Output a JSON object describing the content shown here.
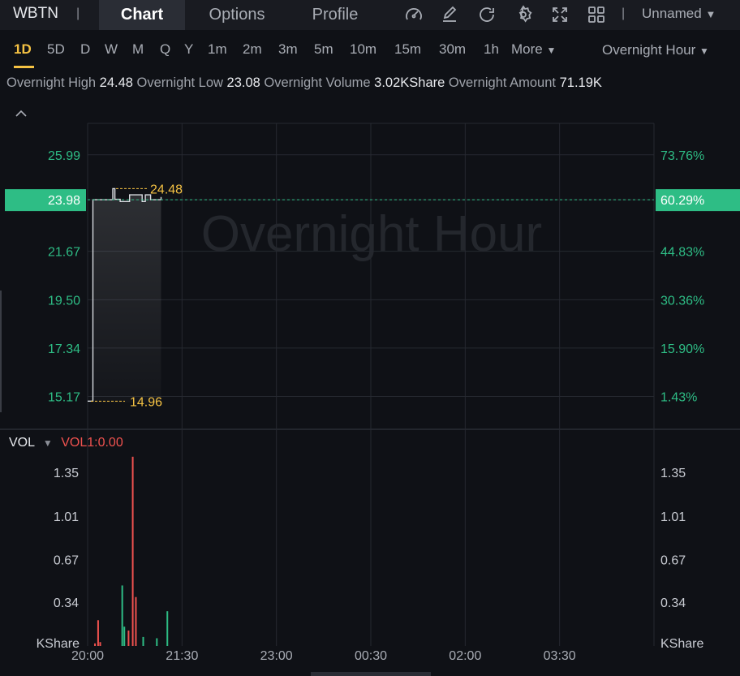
{
  "header": {
    "ticker": "WBTN",
    "tabs": [
      {
        "label": "Chart",
        "active": true
      },
      {
        "label": "Options",
        "active": false
      },
      {
        "label": "Profile",
        "active": false
      }
    ],
    "icons": [
      "gauge-icon",
      "draw-icon",
      "refresh-icon",
      "gear-icon",
      "fullscreen-icon",
      "layout-icon"
    ],
    "layout_name": "Unnamed"
  },
  "timeframes": {
    "items": [
      "1D",
      "5D",
      "D",
      "W",
      "M",
      "Q",
      "Y",
      "1m",
      "2m",
      "3m",
      "5m",
      "10m",
      "15m",
      "30m",
      "1h"
    ],
    "active": "1D",
    "more_label": "More",
    "session_label": "Overnight Hour"
  },
  "stats": {
    "high_label": "Overnight High",
    "high_value": "24.48",
    "low_label": "Overnight Low",
    "low_value": "23.08",
    "volume_label": "Overnight Volume",
    "volume_value": "3.02KShare",
    "amount_label": "Overnight Amount",
    "amount_value": "71.19K"
  },
  "colors": {
    "up": "#2ebd85",
    "down": "#f0524f",
    "accent": "#f5c243",
    "price_line": "#d8dbe0"
  },
  "chart_data": [
    {
      "type": "line",
      "watermark": "Overnight Hour",
      "x_ticks": [
        "20:00",
        "21:30",
        "23:00",
        "00:30",
        "02:00",
        "03:30"
      ],
      "x_minutes": [
        0,
        5,
        5,
        11,
        11,
        24,
        24,
        26,
        26,
        31,
        31,
        40,
        40,
        52,
        52,
        55,
        55,
        60,
        60,
        66,
        66,
        70,
        70
      ],
      "y": [
        14.96,
        14.96,
        23.98,
        23.98,
        23.98,
        23.98,
        24.48,
        24.48,
        24.0,
        24.0,
        23.9,
        23.9,
        24.2,
        24.2,
        23.9,
        23.9,
        24.2,
        24.2,
        23.98,
        23.98,
        23.98,
        23.98,
        24.1
      ],
      "y_ticks_left": [
        "25.99",
        "23.98",
        "21.67",
        "19.50",
        "17.34",
        "15.17"
      ],
      "y_ticks_right": [
        "73.76%",
        "60.29%",
        "44.83%",
        "30.36%",
        "15.90%",
        "1.43%"
      ],
      "ylim": [
        13.7,
        27.4
      ],
      "last_price": "23.98",
      "last_pct": "60.29%",
      "max_label": "24.48",
      "min_label": "14.96",
      "grid": true
    },
    {
      "type": "bar",
      "title": "VOL",
      "indicator": "VOL1:0.00",
      "unit": "KShare",
      "y_ticks": [
        "1.35",
        "1.01",
        "0.67",
        "0.34"
      ],
      "ylim": [
        0,
        1.62
      ],
      "bars": [
        {
          "minute": 7,
          "value": 0.02,
          "dir": "down"
        },
        {
          "minute": 10,
          "value": 0.2,
          "dir": "down"
        },
        {
          "minute": 12,
          "value": 0.03,
          "dir": "down"
        },
        {
          "minute": 33,
          "value": 0.47,
          "dir": "up"
        },
        {
          "minute": 35,
          "value": 0.15,
          "dir": "up"
        },
        {
          "minute": 39,
          "value": 0.12,
          "dir": "down"
        },
        {
          "minute": 43,
          "value": 1.47,
          "dir": "down"
        },
        {
          "minute": 46,
          "value": 0.38,
          "dir": "down"
        },
        {
          "minute": 53,
          "value": 0.07,
          "dir": "up"
        },
        {
          "minute": 66,
          "value": 0.06,
          "dir": "up"
        },
        {
          "minute": 76,
          "value": 0.27,
          "dir": "up"
        }
      ]
    }
  ]
}
